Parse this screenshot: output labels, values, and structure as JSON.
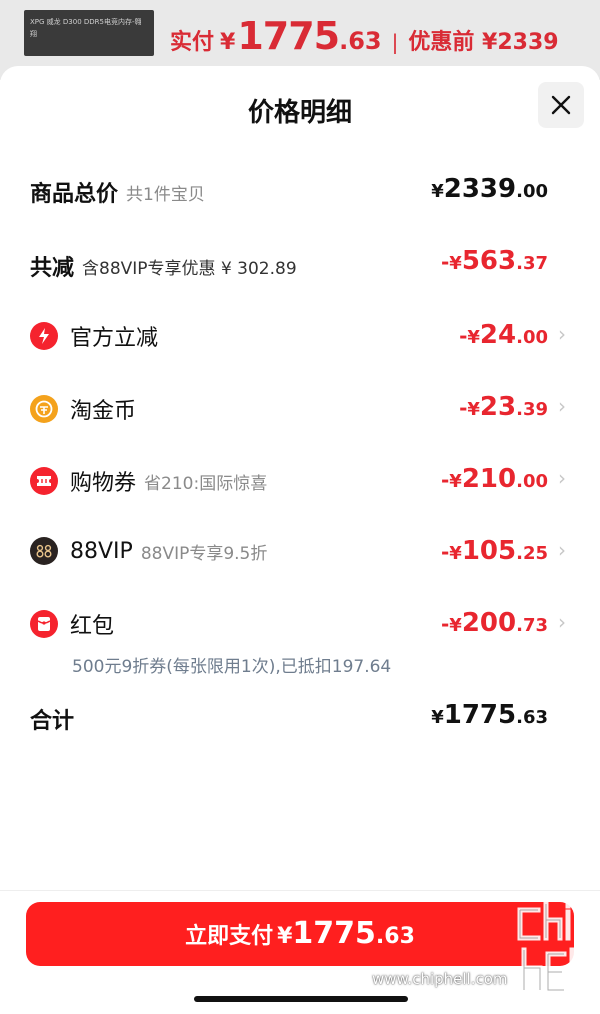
{
  "top": {
    "product_thumb_text": "XPG 威龙 D300 DDR5电竞内存-翱翔",
    "paid_label": "实付",
    "currency": "¥",
    "paid_int": "1775",
    "paid_dec": ".63",
    "separator": "|",
    "original_label": "优惠前 ¥2339"
  },
  "sheet": {
    "title": "价格明细",
    "close_icon": "close-icon"
  },
  "rows": {
    "total": {
      "label": "商品总价",
      "sub": "共1件宝贝",
      "cur": "¥",
      "int": "2339",
      "dec": ".00"
    },
    "reduce": {
      "label": "共减",
      "sub": "含88VIP专享优惠 ¥ 302.89",
      "minus": "-",
      "cur": "¥",
      "int": "563",
      "dec": ".37"
    },
    "official": {
      "label": "官方立减",
      "sub": "",
      "minus": "-",
      "cur": "¥",
      "int": "24",
      "dec": ".00",
      "icon": "lightning-icon",
      "color": "#f5232e"
    },
    "coin": {
      "label": "淘金币",
      "sub": "",
      "minus": "-",
      "cur": "¥",
      "int": "23",
      "dec": ".39",
      "icon": "coin-icon",
      "color": "#f4a21c"
    },
    "coupon": {
      "label": "购物券",
      "sub": "省210:国际惊喜",
      "minus": "-",
      "cur": "¥",
      "int": "210",
      "dec": ".00",
      "icon": "ticket-icon",
      "color": "#f5232e"
    },
    "vip": {
      "label": "88VIP",
      "sub": "88VIP专享9.5折",
      "minus": "-",
      "cur": "¥",
      "int": "105",
      "dec": ".25",
      "icon": "vip-88-icon",
      "color": "#2a2321"
    },
    "redpacket": {
      "label": "红包",
      "sub": "",
      "minus": "-",
      "cur": "¥",
      "int": "200",
      "dec": ".73",
      "icon": "red-packet-icon",
      "color": "#f5232e",
      "note": "500元9折券(每张限用1次),已抵扣197.64"
    },
    "sum": {
      "label": "合计",
      "cur": "¥",
      "int": "1775",
      "dec": ".63"
    }
  },
  "pay": {
    "label": "立即支付",
    "cur": "¥",
    "int": "1775",
    "dec": ".63"
  },
  "watermark": {
    "url": "www.chiphell.com"
  },
  "colors": {
    "accent_red": "#e8262f",
    "button_red": "#ff1f1f"
  }
}
